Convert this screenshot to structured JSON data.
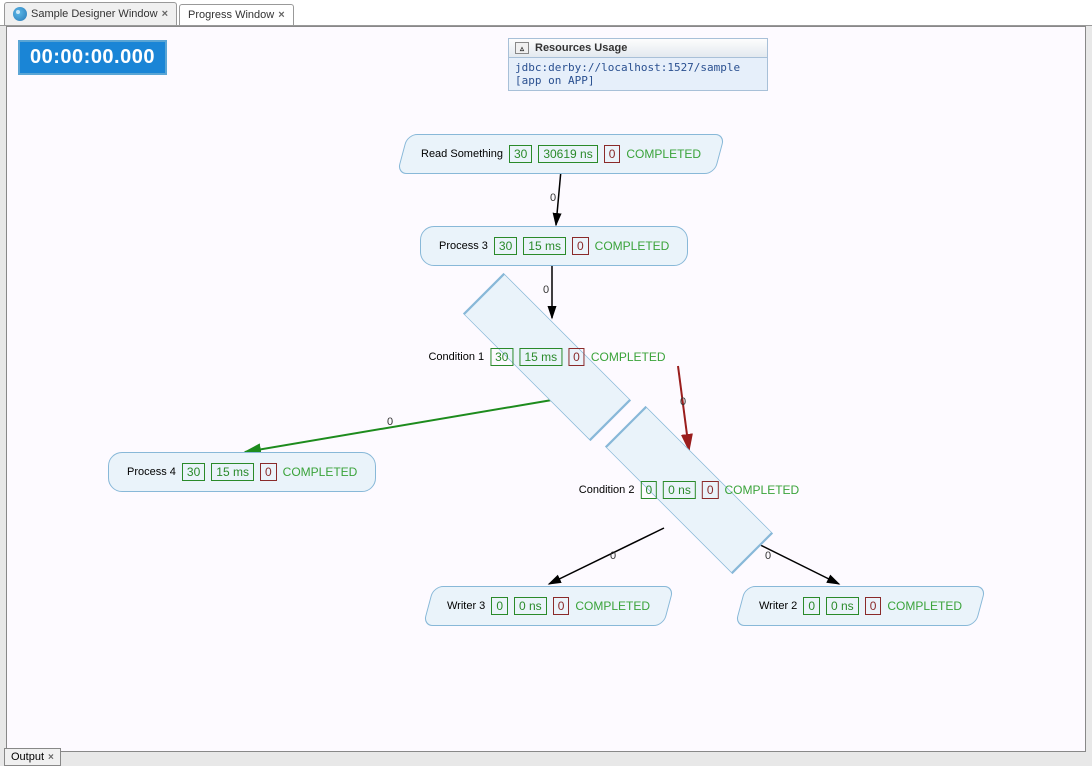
{
  "tabs": [
    {
      "label": "Sample Designer Window"
    },
    {
      "label": "Progress Window"
    }
  ],
  "timer": "00:00:00.000",
  "resources": {
    "title": "Resources Usage",
    "row": "jdbc:derby://localhost:1527/sample [app on APP]"
  },
  "bottom_tab": "Output",
  "nodes": {
    "read": {
      "label": "Read Something",
      "count": "30",
      "time": "30619 ns",
      "err": "0",
      "status": "COMPLETED"
    },
    "proc3": {
      "label": "Process 3",
      "count": "30",
      "time": "15 ms",
      "err": "0",
      "status": "COMPLETED"
    },
    "cond1": {
      "label": "Condition 1",
      "count": "30",
      "time": "15 ms",
      "err": "0",
      "status": "COMPLETED"
    },
    "proc4": {
      "label": "Process 4",
      "count": "30",
      "time": "15 ms",
      "err": "0",
      "status": "COMPLETED"
    },
    "cond2": {
      "label": "Condition 2",
      "count": "0",
      "time": "0 ns",
      "err": "0",
      "status": "COMPLETED"
    },
    "writer3": {
      "label": "Writer 3",
      "count": "0",
      "time": "0 ns",
      "err": "0",
      "status": "COMPLETED"
    },
    "writer2": {
      "label": "Writer 2",
      "count": "0",
      "time": "0 ns",
      "err": "0",
      "status": "COMPLETED"
    }
  },
  "edge_labels": {
    "e1": "0",
    "e2": "0",
    "e3": "0",
    "e4": "0",
    "e5": "0",
    "e6": "0"
  }
}
